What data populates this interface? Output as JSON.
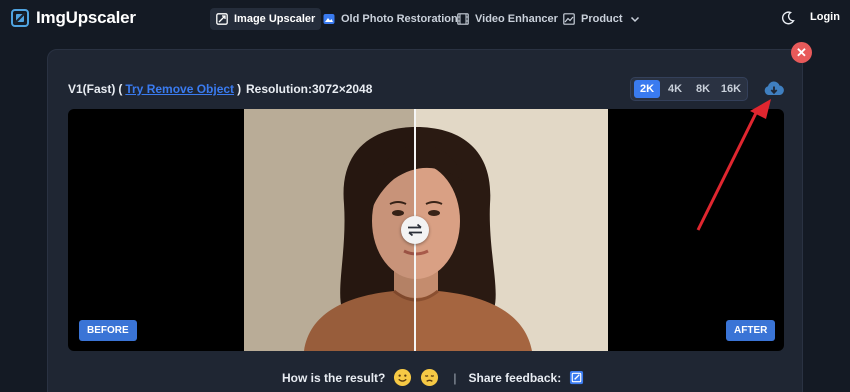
{
  "brand": {
    "name": "ImgUpscaler"
  },
  "nav": {
    "items": [
      {
        "label": "Image Upscaler",
        "icon": "image-upscale-icon",
        "active": true
      },
      {
        "label": "Old Photo Restoration",
        "icon": "photo-icon",
        "active": false
      },
      {
        "label": "Video Enhancer",
        "icon": "film-icon",
        "active": false
      },
      {
        "label": "Product",
        "icon": "product-icon",
        "active": false
      }
    ],
    "login": "Login"
  },
  "result": {
    "model": "V1(Fast)",
    "open_paren": "(",
    "link": "Try Remove Object",
    "close_paren": ")",
    "resolution": "Resolution:3072×2048",
    "scales": [
      "2K",
      "4K",
      "8K",
      "16K"
    ],
    "active_scale": "2K",
    "before_label": "BEFORE",
    "after_label": "AFTER"
  },
  "feedback": {
    "question": "How is the result?",
    "separator": "|",
    "share": "Share feedback:"
  },
  "colors": {
    "accent": "#3a7bf0",
    "close": "#e85a5a",
    "arrow": "#e0262f",
    "background": "#141a24"
  }
}
